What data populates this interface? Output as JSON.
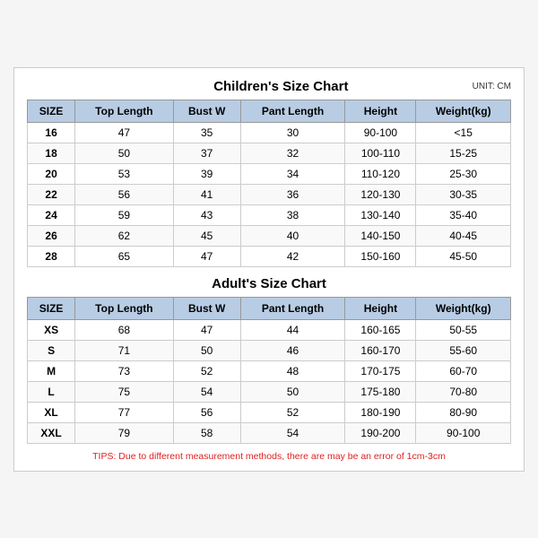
{
  "children": {
    "title": "Children's Size Chart",
    "unit": "UNIT: CM",
    "headers": [
      "SIZE",
      "Top Length",
      "Bust W",
      "Pant Length",
      "Height",
      "Weight(kg)"
    ],
    "rows": [
      [
        "16",
        "47",
        "35",
        "30",
        "90-100",
        "<15"
      ],
      [
        "18",
        "50",
        "37",
        "32",
        "100-110",
        "15-25"
      ],
      [
        "20",
        "53",
        "39",
        "34",
        "110-120",
        "25-30"
      ],
      [
        "22",
        "56",
        "41",
        "36",
        "120-130",
        "30-35"
      ],
      [
        "24",
        "59",
        "43",
        "38",
        "130-140",
        "35-40"
      ],
      [
        "26",
        "62",
        "45",
        "40",
        "140-150",
        "40-45"
      ],
      [
        "28",
        "65",
        "47",
        "42",
        "150-160",
        "45-50"
      ]
    ]
  },
  "adults": {
    "title": "Adult's Size Chart",
    "headers": [
      "SIZE",
      "Top Length",
      "Bust W",
      "Pant Length",
      "Height",
      "Weight(kg)"
    ],
    "rows": [
      [
        "XS",
        "68",
        "47",
        "44",
        "160-165",
        "50-55"
      ],
      [
        "S",
        "71",
        "50",
        "46",
        "160-170",
        "55-60"
      ],
      [
        "M",
        "73",
        "52",
        "48",
        "170-175",
        "60-70"
      ],
      [
        "L",
        "75",
        "54",
        "50",
        "175-180",
        "70-80"
      ],
      [
        "XL",
        "77",
        "56",
        "52",
        "180-190",
        "80-90"
      ],
      [
        "XXL",
        "79",
        "58",
        "54",
        "190-200",
        "90-100"
      ]
    ]
  },
  "tips": "TIPS: Due to different measurement methods, there are may be an error of 1cm-3cm"
}
